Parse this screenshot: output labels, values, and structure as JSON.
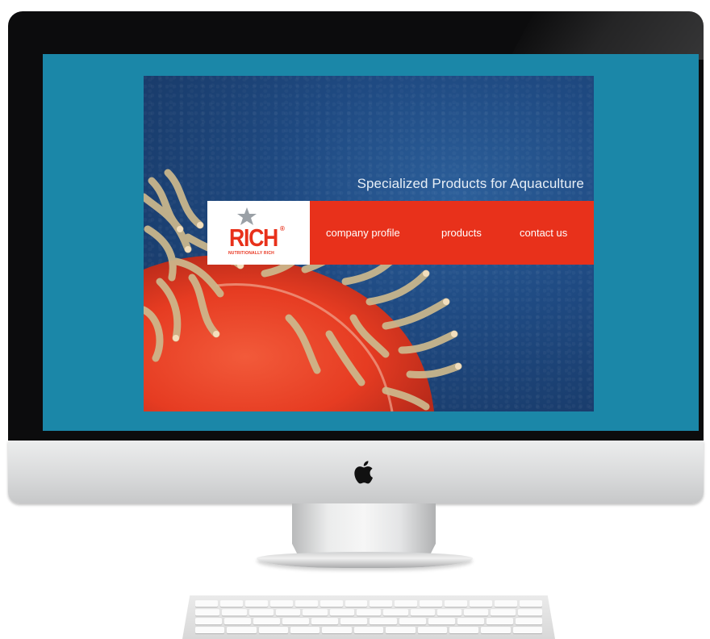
{
  "site": {
    "tagline": "Specialized Products for Aquaculture",
    "logo": {
      "word": "RICH",
      "registered": "®",
      "subline": "NUTRITIONALLY RICH"
    },
    "nav": [
      {
        "label": "company profile"
      },
      {
        "label": "products"
      },
      {
        "label": "contact us"
      }
    ]
  },
  "colors": {
    "screen_background": "#1b87a8",
    "nav_bar": "#e8311b",
    "logo_red": "#e8311b",
    "ocean_blue": "#1f4a82"
  },
  "icons": [
    "apple-logo-icon",
    "star-icon"
  ]
}
